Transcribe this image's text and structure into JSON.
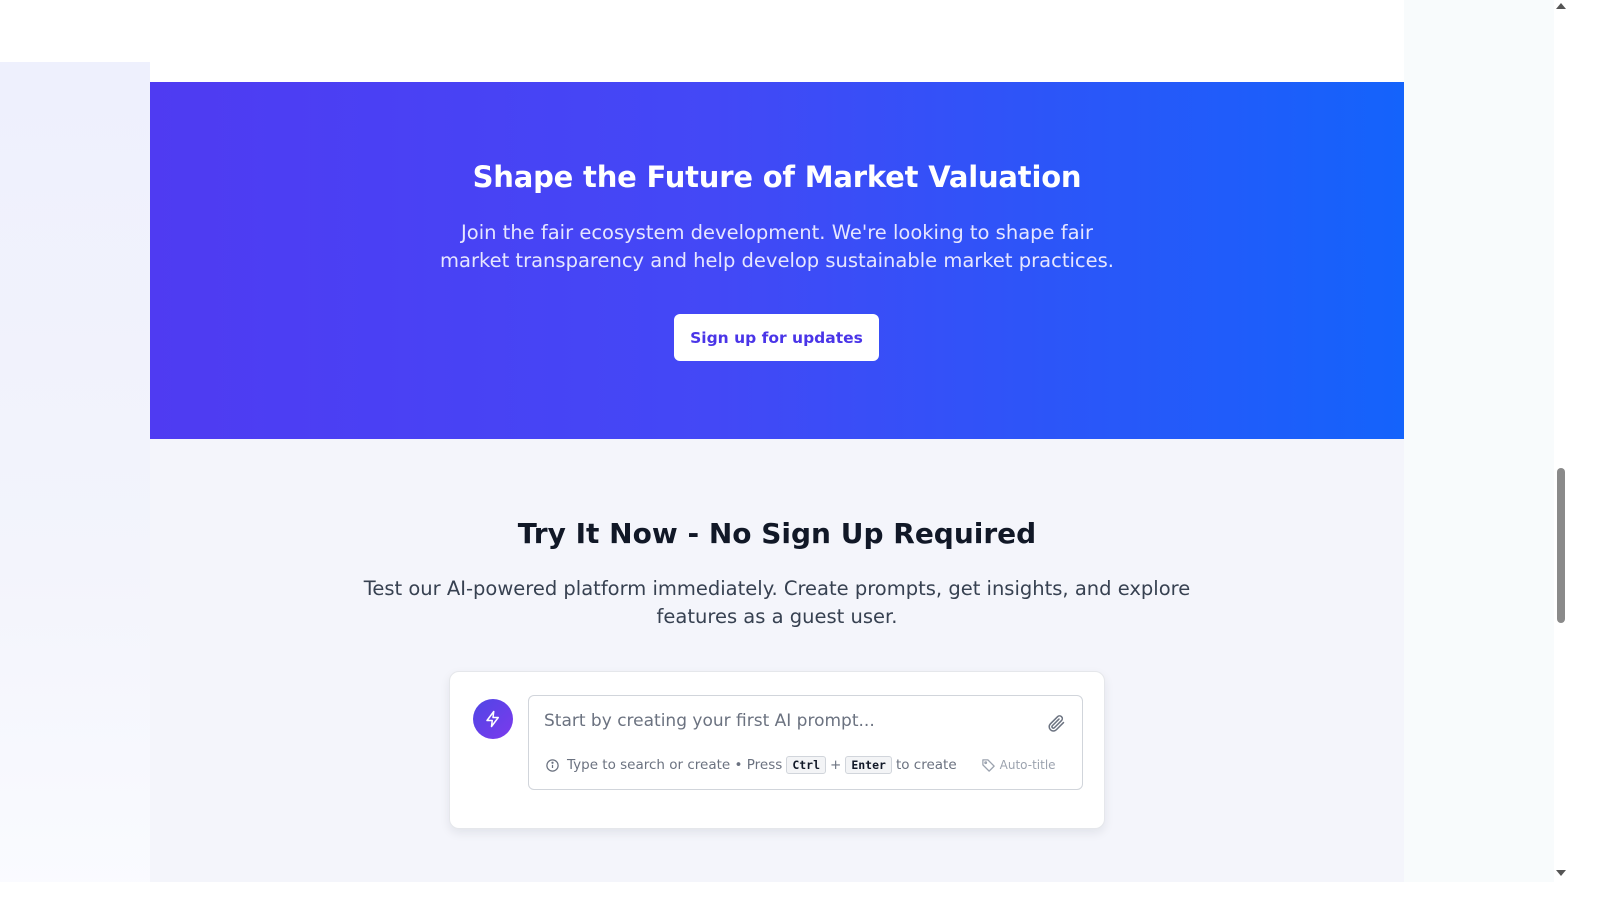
{
  "hero": {
    "title": "Shape the Future of Market Valuation",
    "subtitle": "Join the fair ecosystem development. We're looking to shape fair market transparency and help develop sustainable market practices.",
    "cta_label": "Sign up for updates"
  },
  "try_section": {
    "title": "Try It Now - No Sign Up Required",
    "subtitle": "Test our AI-powered platform immediately. Create prompts, get insights, and explore features as a guest user.",
    "prompt": {
      "placeholder": "Start by creating your first AI prompt...",
      "value": "",
      "hint_prefix": "Type to search or create • Press",
      "key_ctrl": "Ctrl",
      "plus": "+",
      "key_enter": "Enter",
      "hint_suffix": "to create",
      "auto_title_label": "Auto-title"
    }
  },
  "colors": {
    "hero_gradient_start": "#4f3bf2",
    "hero_gradient_end": "#1463fb",
    "accent_button_text": "#4a35e8",
    "bolt_gradient_start": "#4f46e5",
    "bolt_gradient_end": "#7c3aed"
  },
  "icons": {
    "bolt": "lightning-bolt",
    "attach": "paperclip",
    "info": "info-circle",
    "tag": "tag"
  }
}
